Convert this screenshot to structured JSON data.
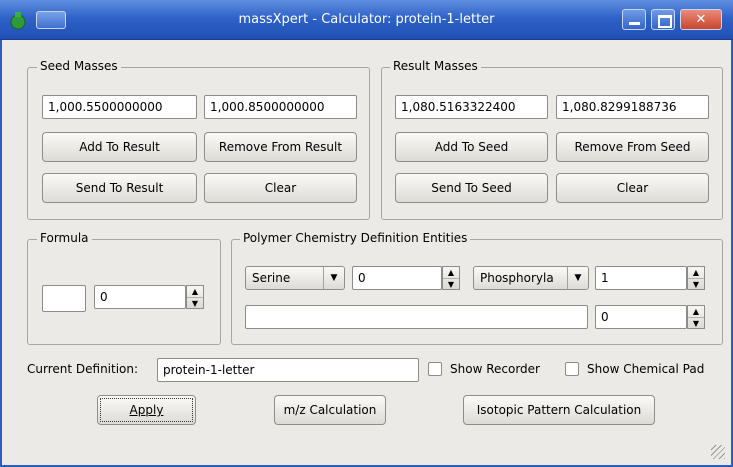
{
  "window": {
    "title": "massXpert - Calculator: protein-1-letter"
  },
  "seed_masses": {
    "title": "Seed Masses",
    "mono": "1,000.5500000000",
    "avg": "1,000.8500000000",
    "add_to_result": "Add To Result",
    "remove_from_result": "Remove From Result",
    "send_to_result": "Send To Result",
    "clear": "Clear"
  },
  "result_masses": {
    "title": "Result Masses",
    "mono": "1,080.5163322400",
    "avg": "1,080.8299188736",
    "add_to_seed": "Add To Seed",
    "remove_from_seed": "Remove From Seed",
    "send_to_seed": "Send To Seed",
    "clear": "Clear"
  },
  "formula": {
    "title": "Formula",
    "text": "",
    "count": "0"
  },
  "polymer_entities": {
    "title": "Polymer Chemistry Definition Entities",
    "monomer": "Serine",
    "monomer_count": "0",
    "modif": "Phosphoryla",
    "modif_count": "1",
    "formula_text": "",
    "formula_count": "0"
  },
  "definition": {
    "label": "Current Definition:",
    "value": "protein-1-letter",
    "show_recorder": "Show Recorder",
    "show_chemical_pad": "Show Chemical Pad"
  },
  "actions": {
    "apply": "Apply",
    "mz": "m/z Calculation",
    "isotopic": "Isotopic Pattern Calculation"
  }
}
